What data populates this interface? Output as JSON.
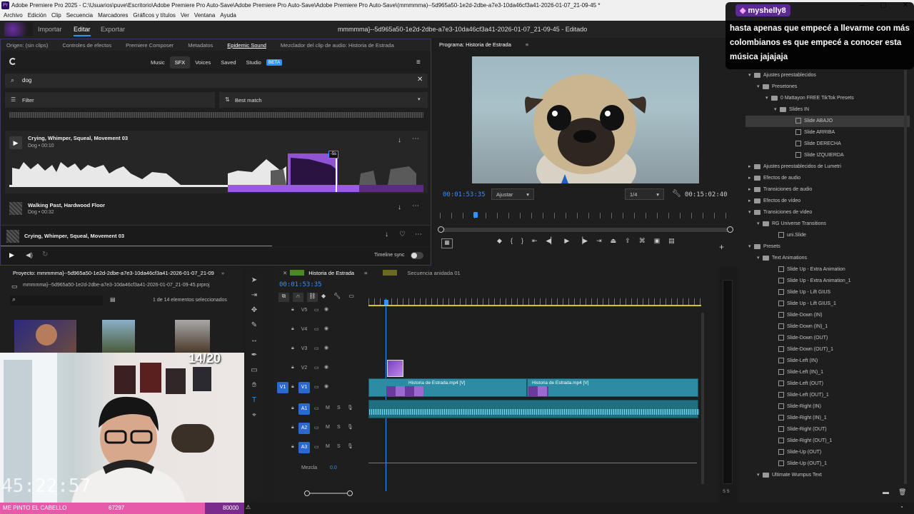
{
  "titlebar": {
    "text": "Adobe Premiere Pro 2025 - C:\\Usuarios\\puve\\Escritorio\\Adobe Premiere Pro Auto-Save\\Adobe Premiere Pro Auto-Save\\Adobe Premiere Pro Auto-Save\\(mmmmma)--5d965a50-1e2d-2dbe-a7e3-10da46cf3a41-2026-01-07_21-09-45 *"
  },
  "menu": [
    "Archivo",
    "Edición",
    "Clip",
    "Secuencia",
    "Marcadores",
    "Gráficos y títulos",
    "Ver",
    "Ventana",
    "Ayuda"
  ],
  "workspaces": {
    "import": "Importar",
    "edit": "Editar",
    "export": "Exportar"
  },
  "project_title": "mmmmma}--5d965a50-1e2d-2dbe-a7e3-10da46cf3a41-2026-01-07_21-09-45 - Editado",
  "top_tabs": [
    "Origen: (sin clips)",
    "Controles de efectos",
    "Premiere Composer",
    "Metadatos",
    "Epidemic Sound",
    "Mezclador del clip de audio: Historia de Estrada"
  ],
  "epidemic": {
    "nav": [
      "Music",
      "SFX",
      "Voices",
      "Saved",
      "Studio"
    ],
    "beta": "BETA",
    "search_value": "dog",
    "filter": "Filter",
    "sort": "Best match",
    "tracks": [
      {
        "title": "Crying, Whimper, Squeal, Movement 03",
        "meta": "Dog • 00:10"
      },
      {
        "title": "Walking Past, Hardwood Floor",
        "meta": "Dog • 00:32"
      }
    ],
    "marker": "-5s",
    "now_playing": "Crying, Whimper, Squeal, Movement 03",
    "timeline_sync": "Timeline sync"
  },
  "program": {
    "tab": "Programa: Historia de Estrada",
    "timecode": "00:01:53:35",
    "fit": "Ajustar",
    "quality": "1/4",
    "duration": "00:15:02:40"
  },
  "chat": {
    "user": "myshelly8",
    "message": "hasta apenas que empecé a llevarme con más colombianos es que empecé a conocer esta música jajajaja"
  },
  "effects": [
    {
      "label": "Ajustes preestablecidos",
      "indent": 0,
      "type": "folder",
      "open": true
    },
    {
      "label": "Presetones",
      "indent": 1,
      "type": "folder",
      "open": true
    },
    {
      "label": "0 Mattayon FREE TikTok Presets",
      "indent": 2,
      "type": "folder",
      "open": true
    },
    {
      "label": "Slides IN",
      "indent": 3,
      "type": "folder",
      "open": true
    },
    {
      "label": "Slide ABAJO",
      "indent": 4,
      "type": "item",
      "selected": true
    },
    {
      "label": "Slide ARRIBA",
      "indent": 4,
      "type": "item"
    },
    {
      "label": "Slide DERECHA",
      "indent": 4,
      "type": "item"
    },
    {
      "label": "Slide IZQUIERDA",
      "indent": 4,
      "type": "item"
    },
    {
      "label": "Ajustes preestablecidos de Lumetri",
      "indent": 0,
      "type": "folder",
      "open": false
    },
    {
      "label": "Efectos de audio",
      "indent": 0,
      "type": "folder",
      "open": false
    },
    {
      "label": "Transiciones de audio",
      "indent": 0,
      "type": "folder",
      "open": false
    },
    {
      "label": "Efectos de vídeo",
      "indent": 0,
      "type": "folder",
      "open": false
    },
    {
      "label": "Transiciones de vídeo",
      "indent": 0,
      "type": "folder",
      "open": true
    },
    {
      "label": "RG Universe Transitions",
      "indent": 1,
      "type": "folder",
      "open": true
    },
    {
      "label": "uni.Slide",
      "indent": 2,
      "type": "item"
    },
    {
      "label": "Presets",
      "indent": 0,
      "type": "folder",
      "open": true
    },
    {
      "label": "Text Animations",
      "indent": 1,
      "type": "folder",
      "open": true
    },
    {
      "label": "Slide Up - Extra Animation",
      "indent": 2,
      "type": "item"
    },
    {
      "label": "Slide Up - Extra Animation_1",
      "indent": 2,
      "type": "item"
    },
    {
      "label": "Slide Up - Lift GIUS",
      "indent": 2,
      "type": "item"
    },
    {
      "label": "Slide Up - Lift GIUS_1",
      "indent": 2,
      "type": "item"
    },
    {
      "label": "Slide-Down (IN)",
      "indent": 2,
      "type": "item"
    },
    {
      "label": "Slide-Down (IN)_1",
      "indent": 2,
      "type": "item"
    },
    {
      "label": "Slide-Down (OUT)",
      "indent": 2,
      "type": "item"
    },
    {
      "label": "Slide-Down (OUT)_1",
      "indent": 2,
      "type": "item"
    },
    {
      "label": "Slide-Left (IN)",
      "indent": 2,
      "type": "item"
    },
    {
      "label": "Slide-Left (IN)_1",
      "indent": 2,
      "type": "item"
    },
    {
      "label": "Slide-Left (OUT)",
      "indent": 2,
      "type": "item"
    },
    {
      "label": "Slide-Left (OUT)_1",
      "indent": 2,
      "type": "item"
    },
    {
      "label": "Slide-Right (IN)",
      "indent": 2,
      "type": "item"
    },
    {
      "label": "Slide-Right (IN)_1",
      "indent": 2,
      "type": "item"
    },
    {
      "label": "Slide-Right (OUT)",
      "indent": 2,
      "type": "item"
    },
    {
      "label": "Slide-Right (OUT)_1",
      "indent": 2,
      "type": "item"
    },
    {
      "label": "Slide-Up (OUT)",
      "indent": 2,
      "type": "item"
    },
    {
      "label": "Slide-Up (OUT)_1",
      "indent": 2,
      "type": "item"
    },
    {
      "label": "Ultimate Wumpus Text",
      "indent": 1,
      "type": "folder",
      "open": true
    }
  ],
  "project": {
    "tab": "Proyecto: mmmmma}--5d965a50-1e2d-2dbe-a7e3-10da46cf3a41-2026-01-07_21-09-45",
    "file": "mmmmma}--5d965a50-1e2d-2dbe-a7e3-10da46cf3a41-2026-01-07_21-09-45.prproj",
    "count": "1 de 14 elementos seleccionados"
  },
  "timeline": {
    "tab": "Historia de Estrada",
    "tab2": "Secuencia anidada 01",
    "timecode": "00:01:53:35",
    "tracks_v": [
      "V5",
      "V4",
      "V3",
      "V2",
      "V1"
    ],
    "tracks_a": [
      "A1",
      "A2",
      "A3"
    ],
    "src_v": "V1",
    "clip1": "Historia de Estrada.mp4 [V]",
    "clip2": "Historia de Estrada.mp4 [V]",
    "mix_label": "Mezcla",
    "mix_value": "0.0",
    "fx": "fx",
    "meter_labels": "S S"
  },
  "stream": {
    "counter": "14/20",
    "bar_left": "ME PINTO EL CABELLO",
    "bar_mid": "67297",
    "bar_right": "80000",
    "progress": 0.84,
    "overlay_clock": "45:22:57"
  },
  "colors": {
    "accent": "#2e93ff",
    "purple": "#9b59e8",
    "chat_name": "#a970ff",
    "stream_bar": "#e75aa9"
  }
}
